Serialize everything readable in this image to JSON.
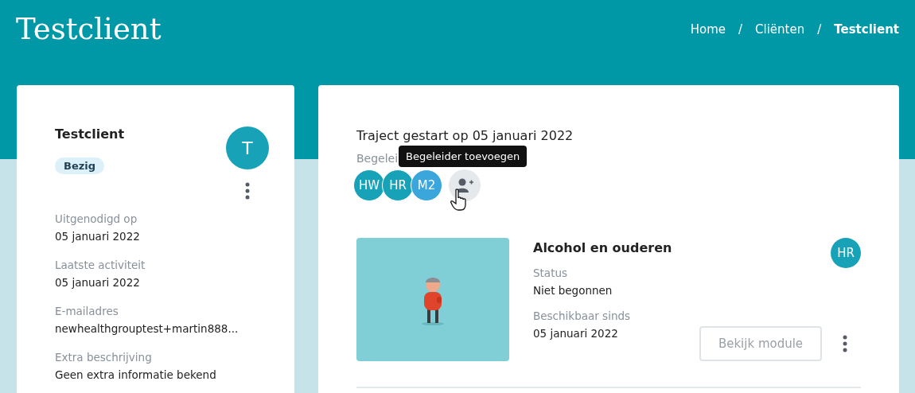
{
  "page_title": "Testclient",
  "breadcrumb": [
    {
      "label": "Home",
      "selected": false
    },
    {
      "label": "Cliënten",
      "selected": false
    },
    {
      "label": "Testclient",
      "selected": true
    }
  ],
  "breadcrumb_separator": "/",
  "client": {
    "name": "Testclient",
    "avatar": "T",
    "status": "Bezig",
    "fields": [
      {
        "label": "Uitgenodigd op",
        "value": "05 januari 2022"
      },
      {
        "label": "Laatste activiteit",
        "value": "05 januari 2022"
      },
      {
        "label": "E-mailadres",
        "value": "newhealthgrouptest+martin888..."
      },
      {
        "label": "Extra beschrijving",
        "value": "Geen extra informatie bekend"
      }
    ]
  },
  "trajectory": {
    "title": "Traject gestart op 05 januari 2022",
    "coaches_label": "Begelei",
    "coaches": [
      {
        "initials": "HW",
        "color": "#17a2b8"
      },
      {
        "initials": "HR",
        "color": "#17a2b8"
      },
      {
        "initials": "M2",
        "color": "#3aa6dc"
      }
    ],
    "tooltip": "Begeleider toevoegen",
    "modules": [
      {
        "kind": "picture",
        "title": "Alcohol en ouderen",
        "coach": "HR",
        "fields": [
          {
            "label": "Status",
            "value": "Niet begonnen"
          },
          {
            "label": "Beschikbaar sinds",
            "value": "05 januari 2022"
          }
        ],
        "button": {
          "label": "Bekijk module",
          "disabled": true
        }
      }
    ]
  }
}
